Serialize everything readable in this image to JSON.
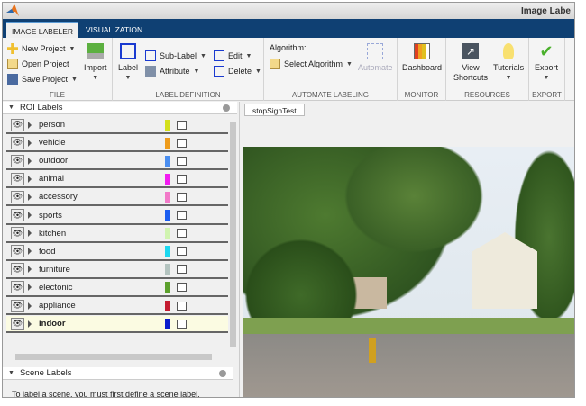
{
  "window": {
    "title": "Image Labe"
  },
  "tabs": [
    {
      "label": "IMAGE LABELER"
    },
    {
      "label": "VISUALIZATION"
    }
  ],
  "ribbon": {
    "file": {
      "label": "FILE",
      "new_project": "New Project",
      "open_project": "Open Project",
      "save_project": "Save Project",
      "import": "Import"
    },
    "label_definition": {
      "label": "LABEL DEFINITION",
      "label_btn": "Label",
      "sub_label": "Sub-Label",
      "attribute": "Attribute",
      "edit": "Edit",
      "delete": "Delete"
    },
    "automate": {
      "label": "AUTOMATE LABELING",
      "algorithm": "Algorithm:",
      "select_algorithm": "Select Algorithm",
      "automate": "Automate"
    },
    "monitor": {
      "label": "MONITOR",
      "dashboard": "Dashboard"
    },
    "resources": {
      "label": "RESOURCES",
      "view_shortcuts_1": "View",
      "view_shortcuts_2": "Shortcuts",
      "tutorials": "Tutorials"
    },
    "export": {
      "label": "EXPORT",
      "export": "Export"
    }
  },
  "roi_panel": {
    "title": "ROI Labels",
    "labels": [
      {
        "name": "person",
        "color": "#d4e01c"
      },
      {
        "name": "vehicle",
        "color": "#ee9c1c"
      },
      {
        "name": "outdoor",
        "color": "#4a8ef0"
      },
      {
        "name": "animal",
        "color": "#f21cf0"
      },
      {
        "name": "accessory",
        "color": "#f27ac8"
      },
      {
        "name": "sports",
        "color": "#1c5ef0"
      },
      {
        "name": "kitchen",
        "color": "#d0f4b0"
      },
      {
        "name": "food",
        "color": "#1cd8f0"
      },
      {
        "name": "furniture",
        "color": "#b4c4c0"
      },
      {
        "name": "electonic",
        "color": "#5ca02c"
      },
      {
        "name": "appliance",
        "color": "#c41c30"
      },
      {
        "name": "indoor",
        "color": "#0a1ccc"
      }
    ]
  },
  "scene_panel": {
    "title": "Scene Labels",
    "message": "To label a scene, you must first define a scene label."
  },
  "document": {
    "tab": "stopSignTest"
  }
}
